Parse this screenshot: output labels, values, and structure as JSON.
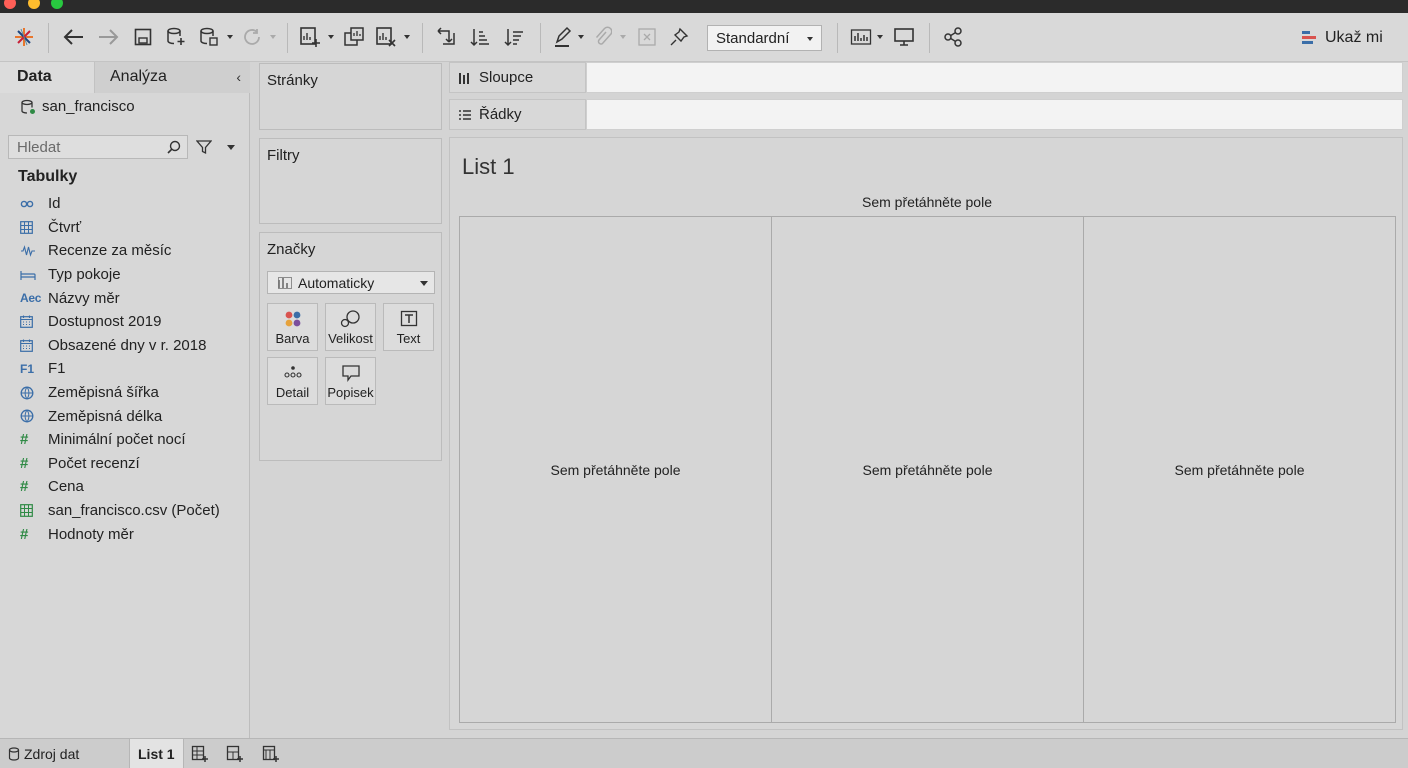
{
  "toolbar": {
    "view_mode": "Standardní",
    "show_me": "Ukaž mi"
  },
  "left_pane": {
    "tab_data": "Data",
    "tab_analysis": "Analýza",
    "datasource": "san_francisco",
    "search_placeholder": "Hledat",
    "tables_heading": "Tabulky",
    "fields": [
      {
        "label": "Id",
        "icon": "link-icon",
        "type": "link"
      },
      {
        "label": "Čtvrť",
        "icon": "table-icon",
        "type": "table"
      },
      {
        "label": "Recenze za měsíc",
        "icon": "wave-icon",
        "type": "wave"
      },
      {
        "label": "Typ pokoje",
        "icon": "bed-icon",
        "type": "bed"
      },
      {
        "label": "Názvy měr",
        "icon": "abc-icon",
        "type": "abc"
      },
      {
        "label": "Dostupnost 2019",
        "icon": "calendar-icon",
        "type": "calendar"
      },
      {
        "label": "Obsazené dny v r. 2018",
        "icon": "calendar-icon",
        "type": "calendar"
      },
      {
        "label": "F1",
        "icon": "f1-icon",
        "type": "f1"
      },
      {
        "label": "Zeměpisná šířka",
        "icon": "globe-icon",
        "type": "globe"
      },
      {
        "label": "Zeměpisná délka",
        "icon": "globe-icon",
        "type": "globe"
      },
      {
        "label": "Minimální počet nocí",
        "icon": "hash-icon",
        "type": "hash"
      },
      {
        "label": "Počet recenzí",
        "icon": "hash-icon",
        "type": "hash"
      },
      {
        "label": "Cena",
        "icon": "hash-icon",
        "type": "hash"
      },
      {
        "label": "san_francisco.csv (Počet)",
        "icon": "table-green-icon",
        "type": "tablegreen"
      },
      {
        "label": "Hodnoty měr",
        "icon": "hash-icon",
        "type": "hash"
      }
    ]
  },
  "cards": {
    "pages": "Stránky",
    "filters": "Filtry",
    "marks": "Značky",
    "mark_type": "Automaticky",
    "mark_buttons": {
      "color": "Barva",
      "size": "Velikost",
      "text": "Text",
      "detail": "Detail",
      "tooltip": "Popisek"
    }
  },
  "shelves": {
    "columns": "Sloupce",
    "rows": "Řádky"
  },
  "canvas": {
    "sheet_title": "List 1",
    "drop_field": "Sem přetáhněte pole"
  },
  "bottom": {
    "datasource_tab": "Zdroj dat",
    "sheet_tab": "List 1"
  },
  "colors": {
    "accent_blue": "#3b6ea8",
    "measure_green": "#2f8a45",
    "traffic_red": "#ff5f57",
    "traffic_yellow": "#febc2e",
    "traffic_green": "#28c840"
  }
}
